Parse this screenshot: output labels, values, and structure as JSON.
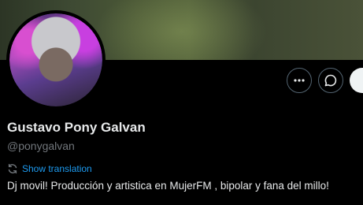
{
  "profile": {
    "name": "Gustavo Pony Galvan",
    "handle": "@ponygalvan",
    "show_translation": "Show translation",
    "bio": "Dj movil! Producción y artistica en MujerFM , bipolar y fana del millo!"
  },
  "icons": {
    "more": "more-icon",
    "message": "message-icon",
    "translate": "translate-icon"
  },
  "colors": {
    "background": "#000000",
    "link": "#1d9bf0",
    "muted": "#71767b",
    "text": "#e7e9ea"
  }
}
